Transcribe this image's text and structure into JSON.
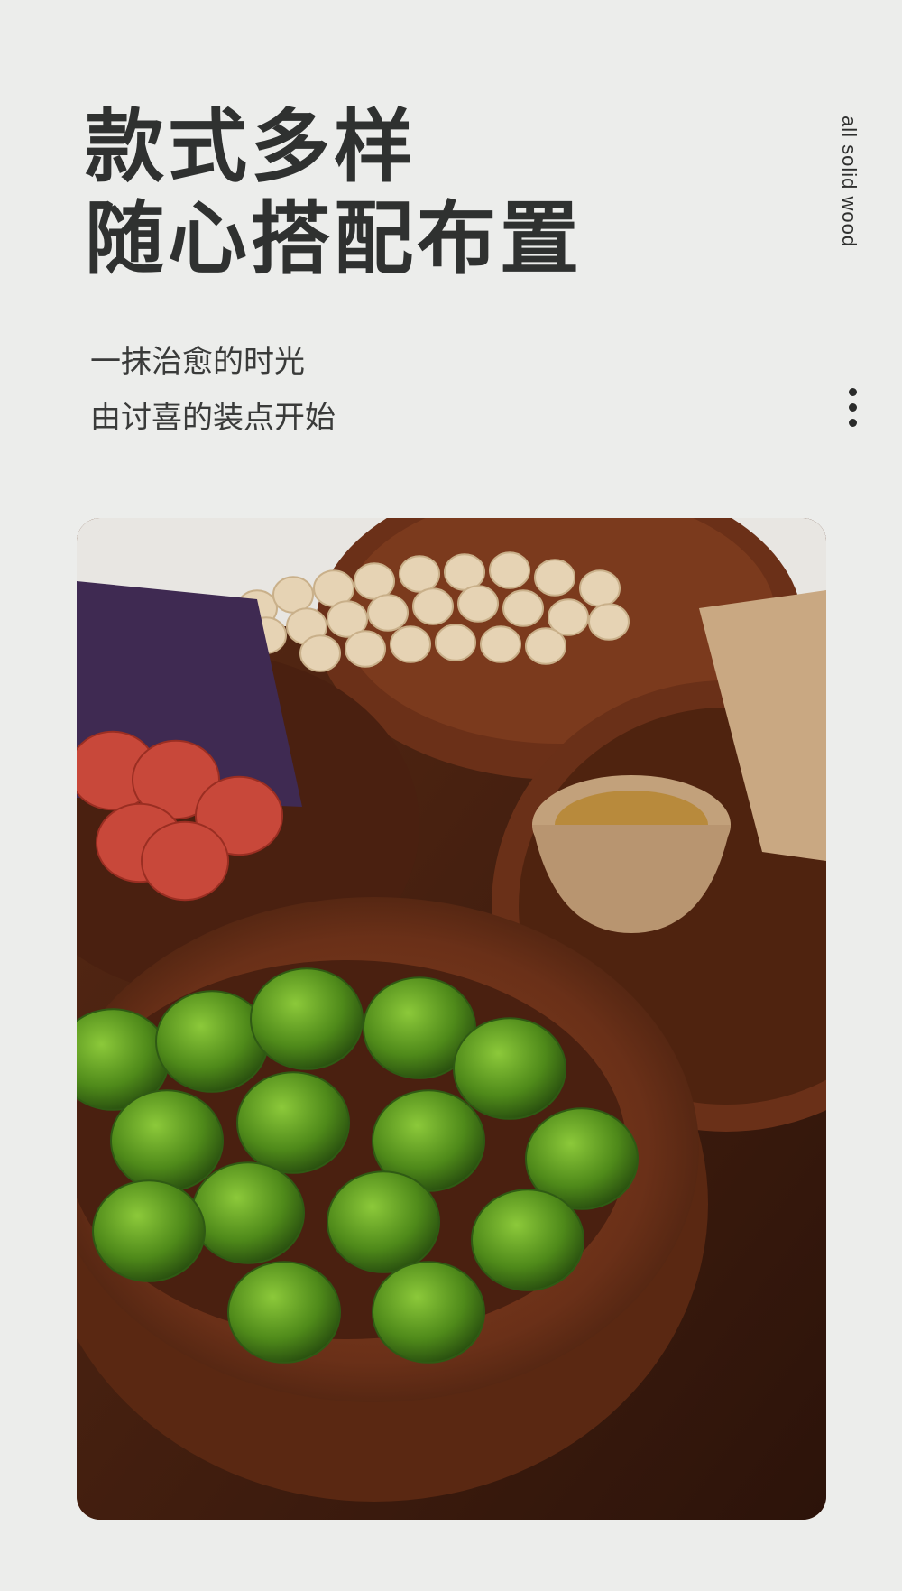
{
  "heading": {
    "line1": "款式多样",
    "line2": "随心搭配布置"
  },
  "subheading": {
    "line1": "一抹治愈的时光",
    "line2": "由讨喜的装点开始"
  },
  "side_label": "all solid wood",
  "menu_icon": "more-vertical-icon",
  "photo": {
    "subject": "wooden-bowls-with-limes-pistachios-dried-persimmons-and-tea",
    "colors": {
      "wood_dark": "#4a2412",
      "wood_mid": "#7a3a1c",
      "wood_light": "#a8562b",
      "lime": "#5f9a1f",
      "lime_dark": "#2f5a14",
      "nut": "#e6d3b4",
      "persimmon": "#c8483a",
      "wrapper": "#3f2a52",
      "cup": "#c9a882",
      "tea": "#b88a3c"
    }
  }
}
